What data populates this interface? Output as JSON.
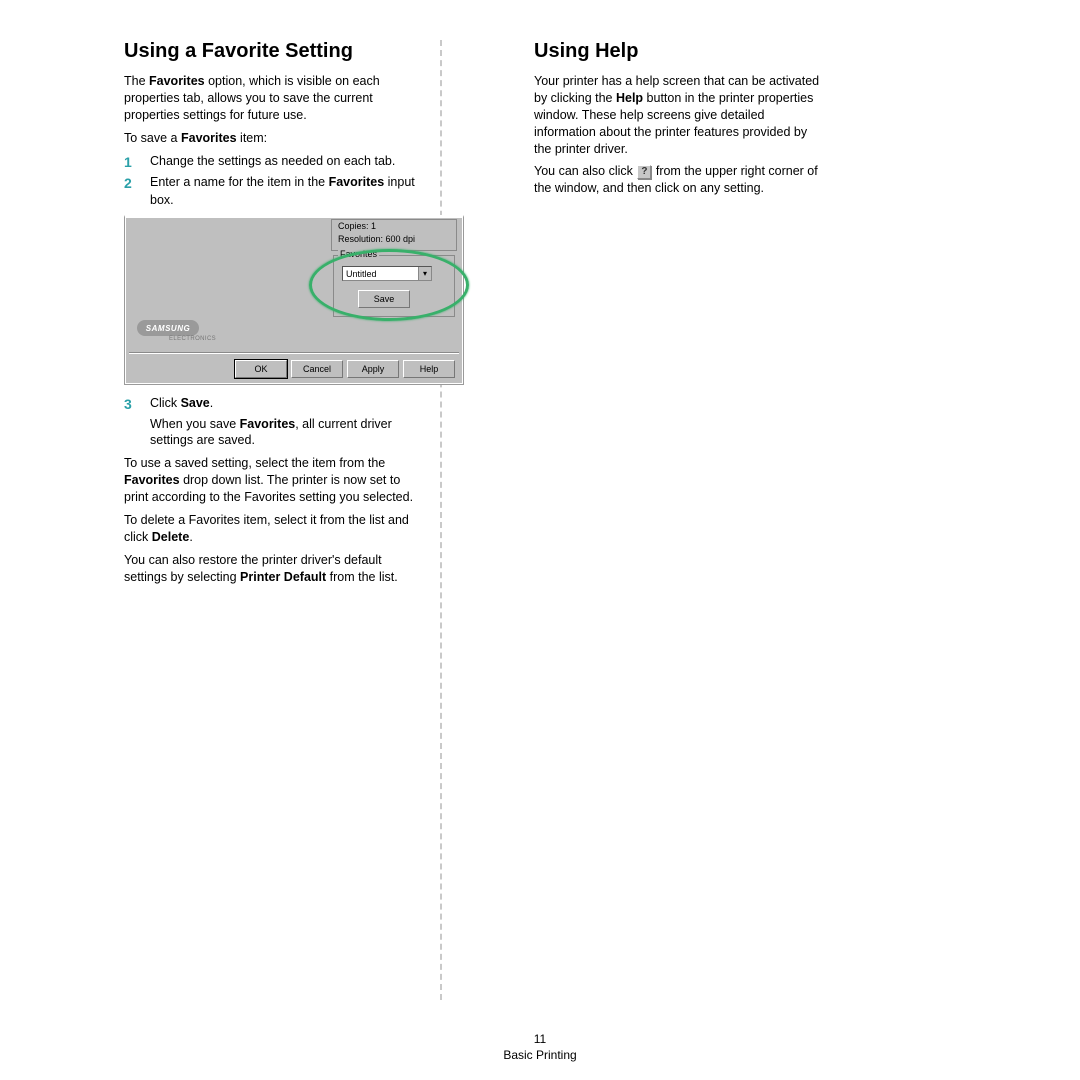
{
  "left": {
    "heading": "Using a Favorite Setting",
    "intro_a": "The ",
    "intro_bold1": "Favorites",
    "intro_b": " option, which is visible on each properties tab, allows you to save the current properties settings for future use.",
    "tosave_a": "To save a ",
    "tosave_bold": "Favorites",
    "tosave_b": " item:",
    "step1": "Change the settings as needed on each tab.",
    "step2_a": "Enter a name for the item in the ",
    "step2_bold": "Favorites",
    "step2_b": " input box.",
    "shot": {
      "copies": "Copies: 1",
      "resolution": "Resolution: 600 dpi",
      "fav_label": "Favorites",
      "combo_value": "Untitled",
      "save_btn": "Save",
      "logo": "SAMSUNG",
      "logo_sub": "ELECTRONICS",
      "ok": "OK",
      "cancel": "Cancel",
      "apply": "Apply",
      "help": "Help"
    },
    "step3_a": "Click ",
    "step3_bold": "Save",
    "step3_b": ".",
    "step3_sub_a": "When you save ",
    "step3_sub_bold": "Favorites",
    "step3_sub_b": ", all current driver settings are saved.",
    "use_a": "To use a saved setting, select the item from the ",
    "use_bold": "Favorites",
    "use_b": " drop down list. The printer is now set to print according to the Favorites setting you selected.",
    "delete_a": "To delete a Favorites item, select it from the list and click ",
    "delete_bold": "Delete",
    "delete_b": ".",
    "restore_a": "You can also restore the printer driver's default settings by selecting ",
    "restore_bold": "Printer Default",
    "restore_b": " from the list."
  },
  "right": {
    "heading": "Using Help",
    "p1_a": "Your printer has a help screen that can be activated by clicking the ",
    "p1_bold": "Help",
    "p1_b": " button in the printer properties window. These help screens give detailed information about the printer features provided by the printer driver.",
    "p2_a": "You can also click ",
    "help_icon": "?",
    "p2_b": " from the upper right corner of the window, and then click on any setting."
  },
  "footer": {
    "page_number": "11",
    "section": "Basic Printing"
  }
}
